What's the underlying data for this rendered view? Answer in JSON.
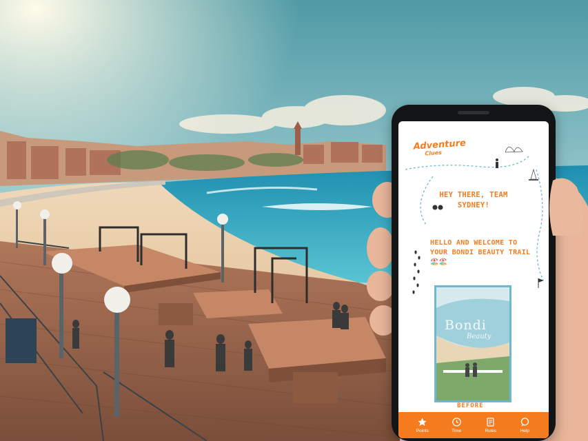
{
  "app": {
    "logo_line1": "Adventure",
    "logo_line2": "Clues"
  },
  "screen": {
    "greeting": "HEY THERE, TEAM SYDNEY!",
    "welcome": "HELLO AND WELCOME TO YOUR BONDI BEAUTY TRAIL 🏖️🏖️",
    "poster_title": "Bondi",
    "poster_subtitle": "Beauty",
    "peek_text": "BEFORE"
  },
  "tabbar": {
    "items": [
      {
        "label": "Points",
        "icon": "star-icon"
      },
      {
        "label": "Time",
        "icon": "clock-icon"
      },
      {
        "label": "Rules",
        "icon": "rules-icon"
      },
      {
        "label": "Help",
        "icon": "chat-help-icon"
      }
    ]
  },
  "colors": {
    "accent": "#f47c1e",
    "poster_border": "#6fb7cc"
  }
}
